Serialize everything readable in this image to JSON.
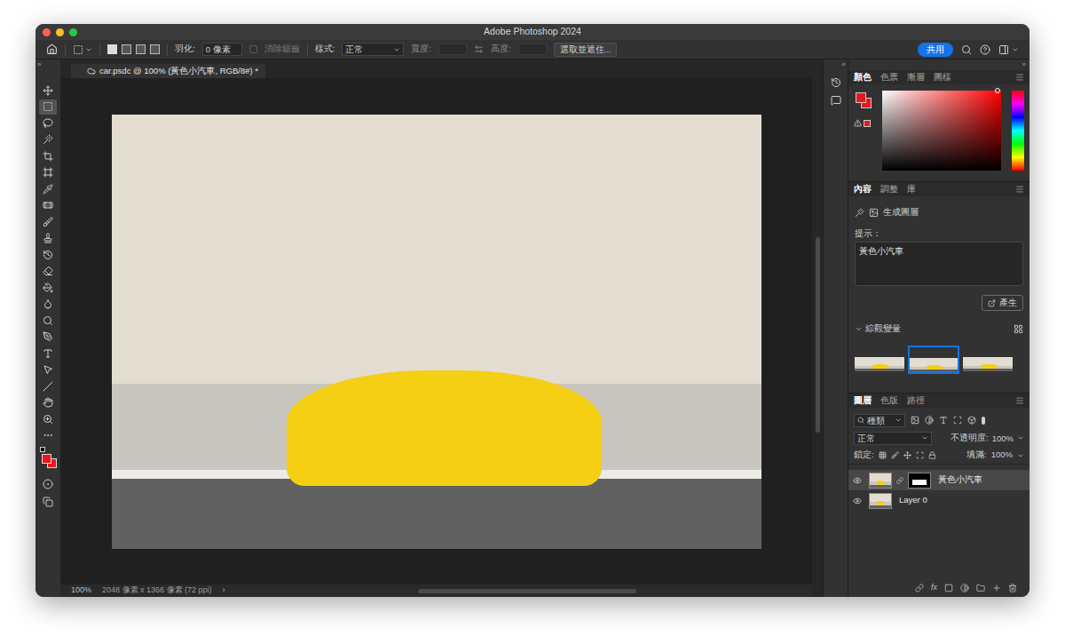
{
  "window": {
    "title": "Adobe Photoshop 2024"
  },
  "options_bar": {
    "selection_modes": [
      {
        "selected": true
      },
      {
        "selected": false
      },
      {
        "selected": false
      },
      {
        "selected": false
      }
    ],
    "feather_label": "羽化:",
    "feather_value": "0 像素",
    "anti_alias": {
      "label": "消除鋸齒",
      "checked": false,
      "disabled": true
    },
    "style_label": "樣式:",
    "style_value": "正常",
    "width_label": "寬度:",
    "height_label": "高度:",
    "select_mask_button": "選取並遮住...",
    "share_button": "共用"
  },
  "collapse_marks": {
    "left": "»",
    "right_strip": "«",
    "right_panel": "»"
  },
  "document_tab": {
    "title": "car.psdc @ 100% (黃色小汽車, RGB/8#) *",
    "selected": true
  },
  "tools": [
    {
      "kind": "move",
      "selected": false
    },
    {
      "kind": "marquee",
      "selected": true
    },
    {
      "kind": "lasso",
      "selected": false
    },
    {
      "kind": "object-select",
      "selected": false
    },
    {
      "kind": "crop",
      "selected": false
    },
    {
      "kind": "frame",
      "selected": false
    },
    {
      "kind": "eyedropper",
      "selected": false
    },
    {
      "kind": "healing",
      "selected": false
    },
    {
      "kind": "brush",
      "selected": false
    },
    {
      "kind": "stamp",
      "selected": false
    },
    {
      "kind": "history-brush",
      "selected": false
    },
    {
      "kind": "eraser",
      "selected": false
    },
    {
      "kind": "gradient",
      "selected": false
    },
    {
      "kind": "blur",
      "selected": false
    },
    {
      "kind": "dodge",
      "selected": false
    },
    {
      "kind": "pen",
      "selected": false
    },
    {
      "kind": "type",
      "selected": false
    },
    {
      "kind": "path-select",
      "selected": false
    },
    {
      "kind": "line",
      "selected": false
    },
    {
      "kind": "hand",
      "selected": false
    },
    {
      "kind": "zoom",
      "selected": false
    },
    {
      "kind": "more",
      "selected": false
    }
  ],
  "colors": {
    "foreground": "#e8181c",
    "background": "#e8181c"
  },
  "color_panel": {
    "tabs": [
      {
        "label": "顏色",
        "selected": true
      },
      {
        "label": "色票",
        "selected": false
      },
      {
        "label": "漸層",
        "selected": false
      },
      {
        "label": "圖樣",
        "selected": false
      }
    ]
  },
  "properties_panel": {
    "tabs": [
      {
        "label": "內容",
        "selected": true
      },
      {
        "label": "調整",
        "selected": false
      },
      {
        "label": "庫",
        "selected": false
      }
    ],
    "layer_type": "生成圖層",
    "prompt_label": "提示：",
    "prompt": "黃色小汽車",
    "generate_button": "產生",
    "variations": {
      "label": "綜觀變量",
      "expanded": true,
      "items": [
        {
          "selected": false
        },
        {
          "selected": true
        },
        {
          "selected": false
        }
      ]
    }
  },
  "layers_panel": {
    "tabs": [
      {
        "label": "圖層",
        "selected": true
      },
      {
        "label": "色版",
        "selected": false
      },
      {
        "label": "路徑",
        "selected": false
      }
    ],
    "filter": "種類",
    "blend_mode": "正常",
    "opacity_label": "不透明度:",
    "opacity": "100%",
    "lock_label": "鎖定:",
    "fill_label": "填滿:",
    "fill": "100%",
    "layers": [
      {
        "name": "黃色小汽車",
        "visible": true,
        "selected": true,
        "has_mask": true
      },
      {
        "name": "Layer 0",
        "visible": true,
        "selected": false,
        "has_mask": false
      }
    ],
    "footer_fx": "fx"
  },
  "status_bar": {
    "zoom": "100%",
    "info": "2048 像素 x 1366 像素 (72 ppi)",
    "more": "›"
  }
}
